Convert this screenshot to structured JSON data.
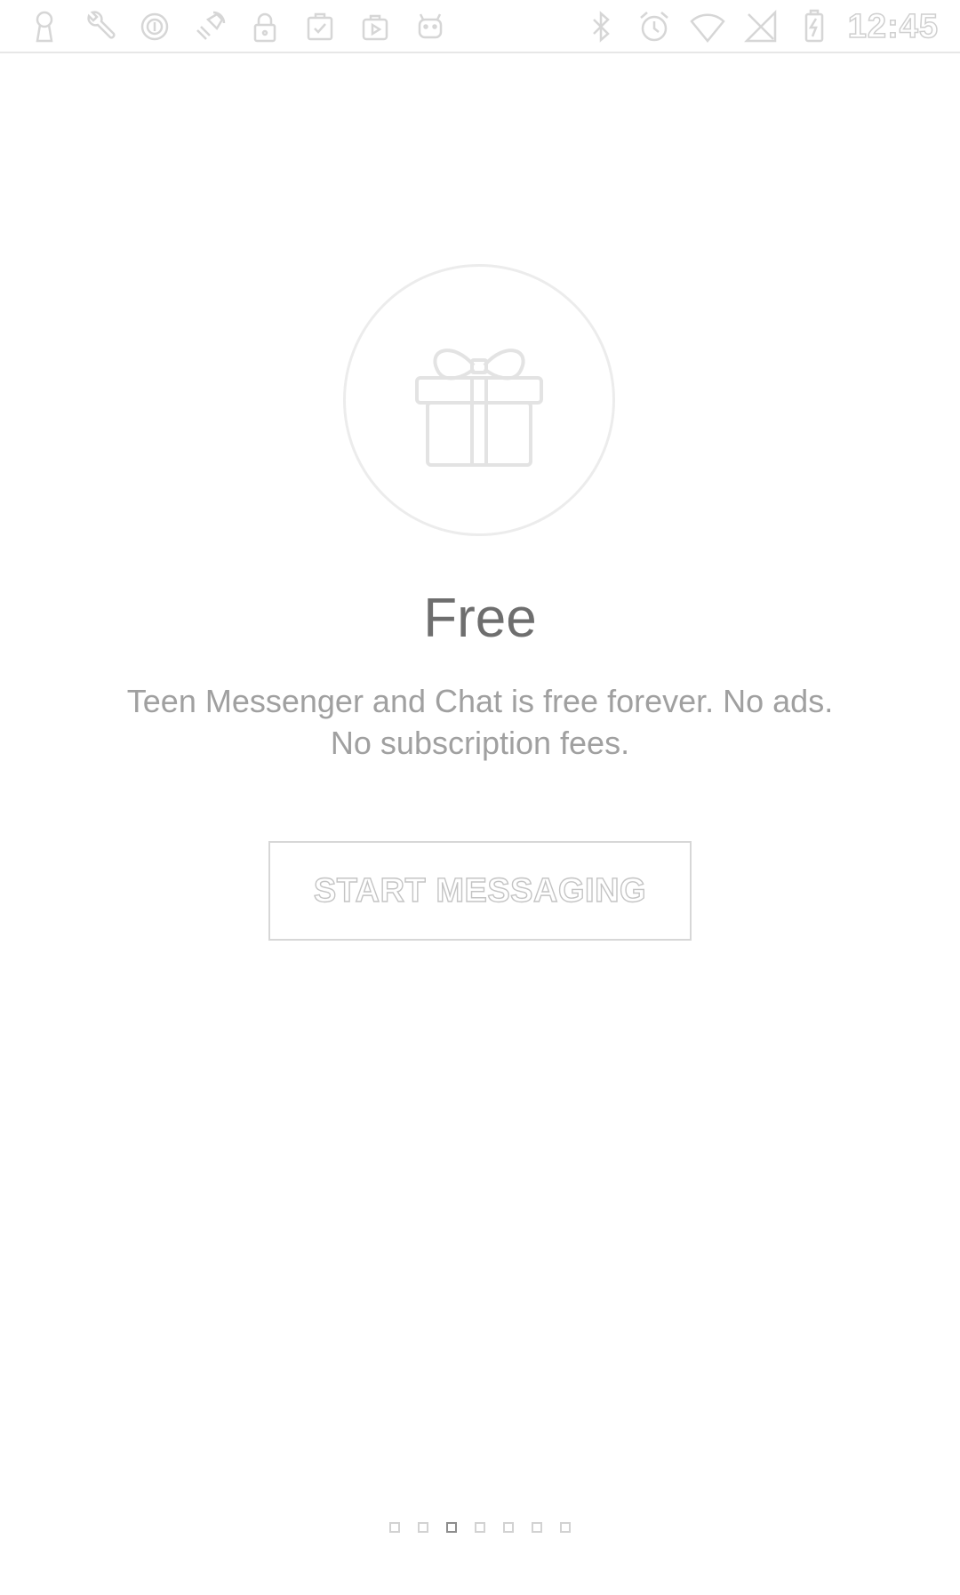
{
  "status_bar": {
    "left_icons": [
      "keyhole-icon",
      "wrench-icon",
      "info-icon",
      "satellite-icon",
      "lock-icon",
      "clipboard-check-icon",
      "play-store-icon",
      "android-icon"
    ],
    "right_icons": [
      "bluetooth-icon",
      "alarm-icon",
      "wifi-icon",
      "no-sim-icon",
      "battery-charging-icon"
    ],
    "time": "12:45"
  },
  "onboarding": {
    "icon": "gift-icon",
    "title": "Free",
    "description_line_1": "Teen Messenger and Chat is free forever. No ads.",
    "description_line_2": "No subscription fees.",
    "button_label": "START MESSAGING"
  },
  "pager": {
    "page_count": 7,
    "active_index": 2
  },
  "colors": {
    "title": "#6e6e6e",
    "description": "#a0a0a0",
    "outline": "#d7d7d7"
  }
}
